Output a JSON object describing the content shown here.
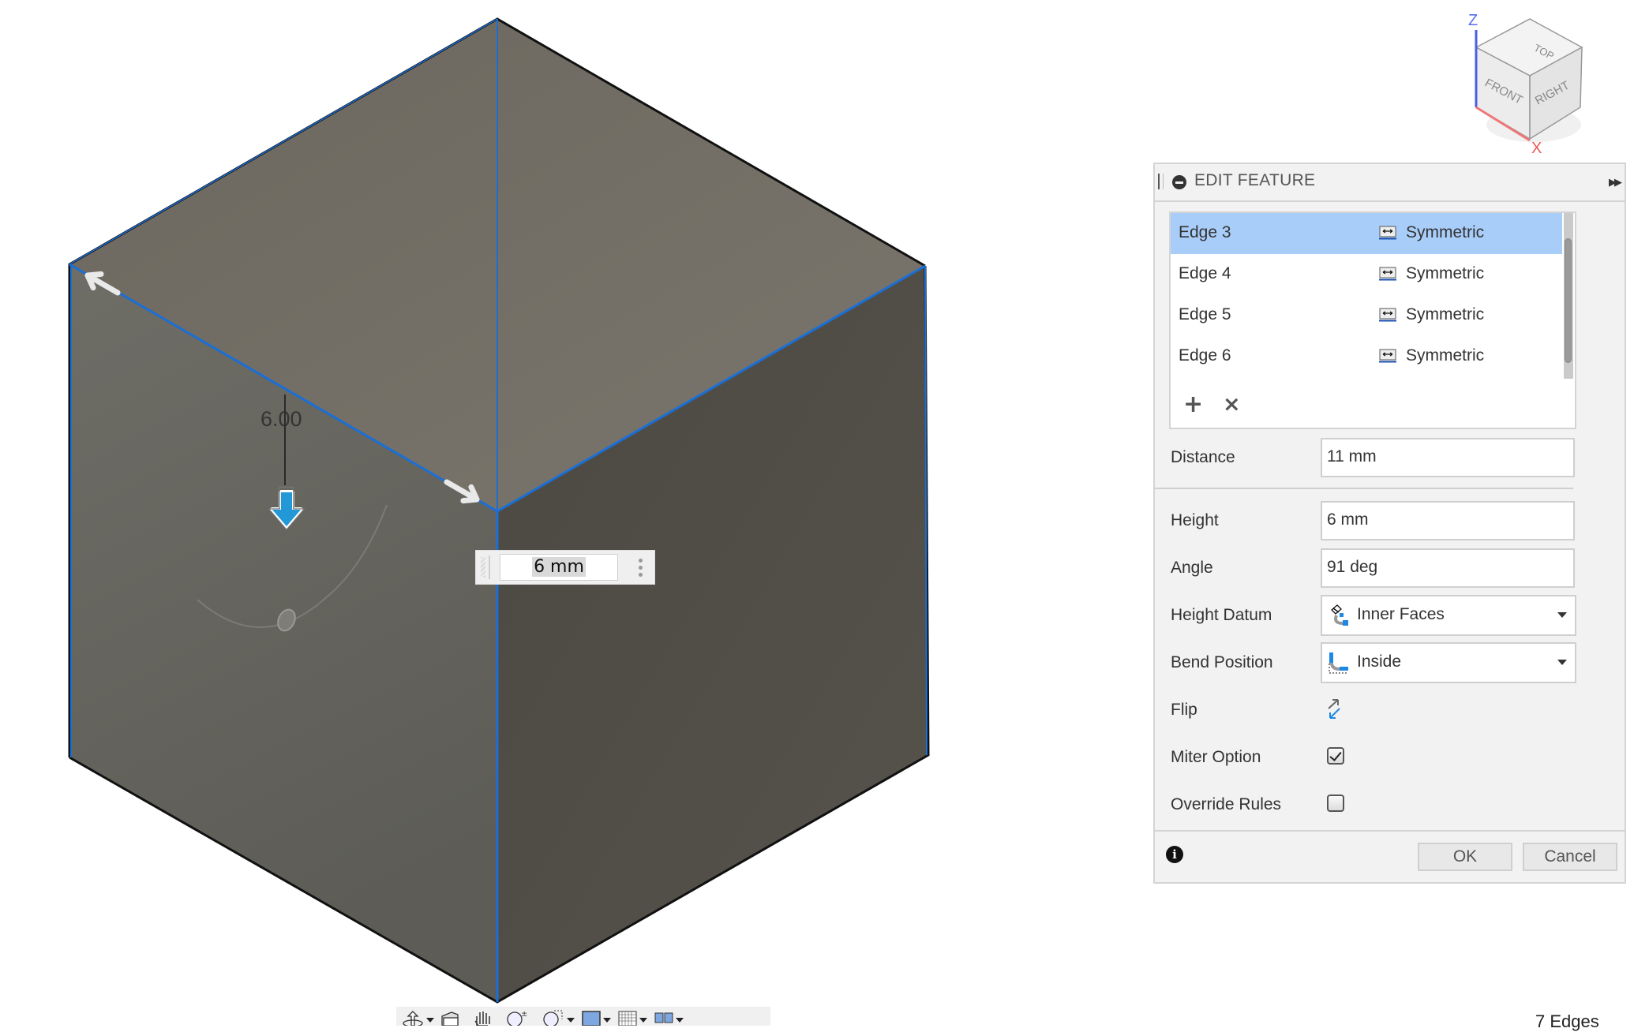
{
  "viewport": {
    "dimension_label": "6.00",
    "dimension_input_value": "6 mm",
    "viewcube": {
      "faces": [
        "TOP",
        "FRONT",
        "RIGHT"
      ],
      "axes": [
        "Z",
        "X"
      ]
    },
    "colors": {
      "top_face": "#716b62",
      "left_face": "#66655e",
      "right_face": "#514d47",
      "edge_highlight": "#1a6fd6",
      "manipulator": "#2299d6"
    }
  },
  "panel": {
    "title": "EDIT FEATURE",
    "edges": [
      {
        "name": "Edge 3",
        "type": "Symmetric",
        "selected": true
      },
      {
        "name": "Edge 4",
        "type": "Symmetric",
        "selected": false
      },
      {
        "name": "Edge 5",
        "type": "Symmetric",
        "selected": false
      },
      {
        "name": "Edge 6",
        "type": "Symmetric",
        "selected": false
      }
    ],
    "add_label": "+",
    "remove_label": "×",
    "fields": {
      "distance": {
        "label": "Distance",
        "value": "11 mm"
      },
      "height": {
        "label": "Height",
        "value": "6 mm"
      },
      "angle": {
        "label": "Angle",
        "value": "91 deg"
      },
      "height_datum": {
        "label": "Height Datum",
        "value": "Inner Faces"
      },
      "bend_position": {
        "label": "Bend Position",
        "value": "Inside"
      },
      "flip": {
        "label": "Flip"
      },
      "miter_option": {
        "label": "Miter Option",
        "checked": true
      },
      "override_rules": {
        "label": "Override Rules",
        "checked": false
      }
    },
    "ok_label": "OK",
    "cancel_label": "Cancel",
    "info_glyph": "i",
    "selection_color": "#a8cdf9"
  },
  "toolbar": {
    "items": [
      "orbit",
      "look-at",
      "pan",
      "zoom",
      "fit",
      "display-settings",
      "grid",
      "viewports"
    ]
  },
  "status": {
    "text": "7 Edges"
  }
}
